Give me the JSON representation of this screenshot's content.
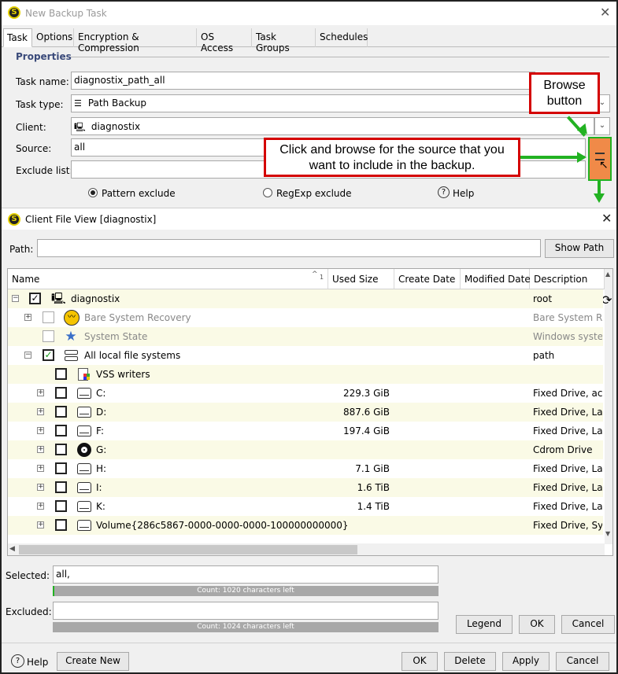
{
  "window": {
    "title": "New Backup Task"
  },
  "tabs": [
    "Task",
    "Options",
    "Encryption & Compression",
    "OS Access",
    "Task Groups",
    "Schedules"
  ],
  "properties": {
    "section_title": "Properties",
    "task_name_label": "Task name:",
    "task_name_value": "diagnostix_path_all",
    "task_type_label": "Task type:",
    "task_type_value": "Path Backup",
    "client_label": "Client:",
    "client_value": "diagnostix",
    "source_label": "Source:",
    "source_value": "all",
    "exclude_label": "Exclude list:",
    "exclude_value": "",
    "pattern_exclude": "Pattern exclude",
    "regexp_exclude": "RegExp exclude",
    "help": "Help",
    "selected_exclude_mode": "Pattern exclude"
  },
  "annotations": {
    "browse_callout": "Browse button",
    "source_callout": "Click and browse for the source that you want to include in the backup."
  },
  "file_view": {
    "title": "Client File View [diagnostix]",
    "path_label": "Path:",
    "path_value": "",
    "show_path": "Show Path",
    "sort_indicator": "1",
    "columns": [
      "Name",
      "Used Size",
      "Create Date",
      "Modified Date",
      "Description"
    ],
    "rows": [
      {
        "name": "diagnostix",
        "size": "",
        "desc": "root",
        "checked": true,
        "icon": "computer-icon",
        "enabled": true
      },
      {
        "name": "Bare System Recovery",
        "size": "",
        "desc": "Bare System Re",
        "checked": false,
        "icon": "recovery-icon",
        "enabled": false
      },
      {
        "name": "System State",
        "size": "",
        "desc": "Windows system",
        "checked": false,
        "icon": "star-icon",
        "enabled": false
      },
      {
        "name": "All local file systems",
        "size": "",
        "desc": "path",
        "checked": true,
        "icon": "server-icon",
        "enabled": true
      },
      {
        "name": "VSS writers",
        "size": "",
        "desc": "",
        "checked": false,
        "icon": "vss-icon",
        "enabled": true
      },
      {
        "name": "C:",
        "size": "229.3 GiB",
        "desc": "Fixed Drive, acti",
        "checked": false,
        "icon": "drive-icon",
        "enabled": true
      },
      {
        "name": "D:",
        "size": "887.6 GiB",
        "desc": "Fixed Drive, Lab",
        "checked": false,
        "icon": "drive-icon",
        "enabled": true
      },
      {
        "name": "F:",
        "size": "197.4 GiB",
        "desc": "Fixed Drive, Lab",
        "checked": false,
        "icon": "drive-icon",
        "enabled": true
      },
      {
        "name": "G:",
        "size": "",
        "desc": "Cdrom Drive",
        "checked": false,
        "icon": "cdrom-icon",
        "enabled": true
      },
      {
        "name": "H:",
        "size": "7.1 GiB",
        "desc": "Fixed Drive, Lab",
        "checked": false,
        "icon": "drive-icon",
        "enabled": true
      },
      {
        "name": "I:",
        "size": "1.6 TiB",
        "desc": "Fixed Drive, Lab",
        "checked": false,
        "icon": "drive-icon",
        "enabled": true
      },
      {
        "name": "K:",
        "size": "1.4 TiB",
        "desc": "Fixed Drive, Lab",
        "checked": false,
        "icon": "drive-icon",
        "enabled": true
      },
      {
        "name": "Volume{286c5867-0000-0000-0000-100000000000}",
        "size": "",
        "desc": "Fixed Drive, Sys",
        "checked": false,
        "icon": "drive-icon",
        "enabled": true
      }
    ],
    "selected_label": "Selected:",
    "selected_value": "all,",
    "selected_count": "Count: 1020 characters left",
    "excluded_label": "Excluded:",
    "excluded_value": "",
    "excluded_count": "Count: 1024 characters left",
    "legend": "Legend",
    "ok": "OK",
    "cancel": "Cancel"
  },
  "footer": {
    "help": "Help",
    "create_new": "Create New",
    "ok": "OK",
    "delete": "Delete",
    "apply": "Apply",
    "cancel": "Cancel"
  },
  "colors": {
    "callout_border": "#d40000",
    "arrow_green": "#22b222",
    "browse_orange": "#f08a48",
    "row_alt": "#fafae6"
  }
}
